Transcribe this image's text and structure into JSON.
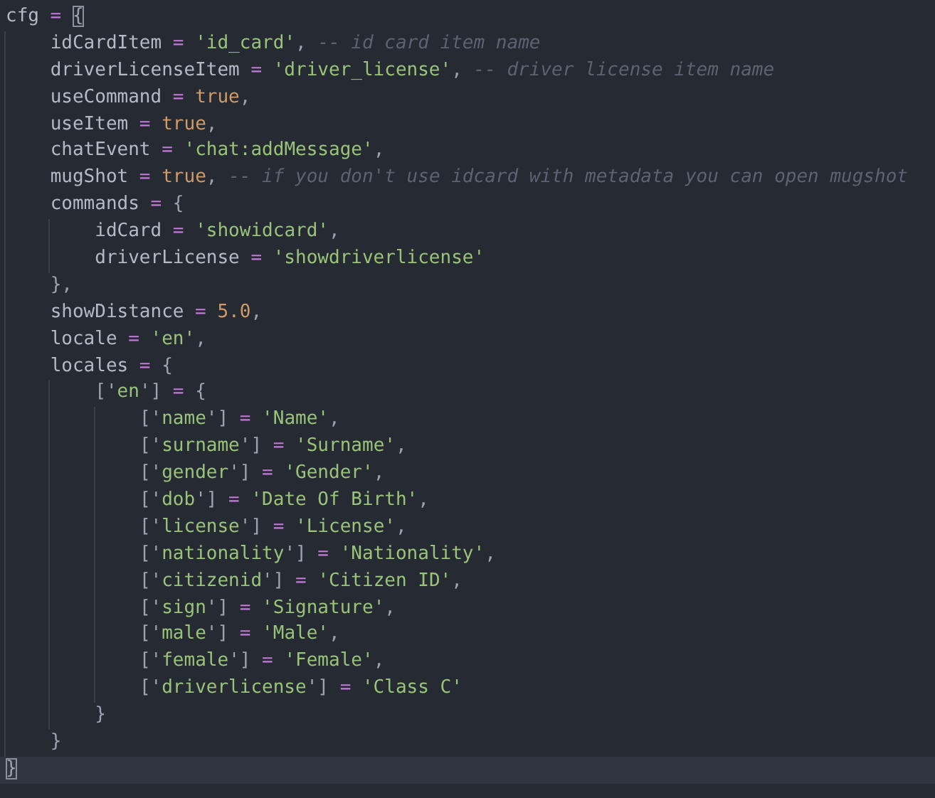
{
  "editor": {
    "lines": [
      {
        "current": false,
        "tokens": [
          {
            "kind": "id",
            "text": "cfg"
          },
          {
            "kind": "op",
            "text": " = "
          },
          {
            "kind": "pun",
            "text": "{",
            "matched": true
          }
        ],
        "children": [
          {
            "current": false,
            "tokens": [
              {
                "kind": "id",
                "text": "idCardItem"
              },
              {
                "kind": "op",
                "text": " = "
              },
              {
                "kind": "str",
                "text": "'id_card'"
              },
              {
                "kind": "pun",
                "text": ", "
              },
              {
                "kind": "cmt",
                "text": "-- id card item name"
              }
            ]
          },
          {
            "current": false,
            "tokens": [
              {
                "kind": "id",
                "text": "driverLicenseItem"
              },
              {
                "kind": "op",
                "text": " = "
              },
              {
                "kind": "str",
                "text": "'driver_license'"
              },
              {
                "kind": "pun",
                "text": ", "
              },
              {
                "kind": "cmt",
                "text": "-- driver license item name"
              }
            ]
          },
          {
            "current": false,
            "tokens": [
              {
                "kind": "id",
                "text": "useCommand"
              },
              {
                "kind": "op",
                "text": " = "
              },
              {
                "kind": "lit",
                "text": "true"
              },
              {
                "kind": "pun",
                "text": ","
              }
            ]
          },
          {
            "current": false,
            "tokens": [
              {
                "kind": "id",
                "text": "useItem"
              },
              {
                "kind": "op",
                "text": " = "
              },
              {
                "kind": "lit",
                "text": "true"
              },
              {
                "kind": "pun",
                "text": ","
              }
            ]
          },
          {
            "current": false,
            "tokens": [
              {
                "kind": "id",
                "text": "chatEvent"
              },
              {
                "kind": "op",
                "text": " = "
              },
              {
                "kind": "str",
                "text": "'chat:addMessage'"
              },
              {
                "kind": "pun",
                "text": ","
              }
            ]
          },
          {
            "current": false,
            "tokens": [
              {
                "kind": "id",
                "text": "mugShot"
              },
              {
                "kind": "op",
                "text": " = "
              },
              {
                "kind": "lit",
                "text": "true"
              },
              {
                "kind": "pun",
                "text": ", "
              },
              {
                "kind": "cmt",
                "text": "-- if you don't use idcard with metadata you can open mugshot"
              }
            ]
          },
          {
            "current": false,
            "tokens": [
              {
                "kind": "id",
                "text": "commands"
              },
              {
                "kind": "op",
                "text": " = "
              },
              {
                "kind": "pun",
                "text": "{"
              }
            ],
            "children": [
              {
                "current": false,
                "tokens": [
                  {
                    "kind": "id",
                    "text": "idCard"
                  },
                  {
                    "kind": "op",
                    "text": " = "
                  },
                  {
                    "kind": "str",
                    "text": "'showidcard'"
                  },
                  {
                    "kind": "pun",
                    "text": ","
                  }
                ]
              },
              {
                "current": false,
                "tokens": [
                  {
                    "kind": "id",
                    "text": "driverLicense"
                  },
                  {
                    "kind": "op",
                    "text": " = "
                  },
                  {
                    "kind": "str",
                    "text": "'showdriverlicense'"
                  }
                ]
              }
            ]
          },
          {
            "current": false,
            "tokens": [
              {
                "kind": "pun",
                "text": "},"
              }
            ]
          },
          {
            "current": false,
            "tokens": [
              {
                "kind": "id",
                "text": "showDistance"
              },
              {
                "kind": "op",
                "text": " = "
              },
              {
                "kind": "lit",
                "text": "5.0"
              },
              {
                "kind": "pun",
                "text": ","
              }
            ]
          },
          {
            "current": false,
            "tokens": [
              {
                "kind": "id",
                "text": "locale"
              },
              {
                "kind": "op",
                "text": " = "
              },
              {
                "kind": "str",
                "text": "'en'"
              },
              {
                "kind": "pun",
                "text": ","
              }
            ]
          },
          {
            "current": false,
            "tokens": [
              {
                "kind": "id",
                "text": "locales"
              },
              {
                "kind": "op",
                "text": " = "
              },
              {
                "kind": "pun",
                "text": "{"
              }
            ],
            "children": [
              {
                "current": false,
                "tokens": [
                  {
                    "kind": "pun",
                    "text": "['"
                  },
                  {
                    "kind": "str",
                    "text": "en"
                  },
                  {
                    "kind": "pun",
                    "text": "']"
                  },
                  {
                    "kind": "op",
                    "text": " = "
                  },
                  {
                    "kind": "pun",
                    "text": "{"
                  }
                ],
                "children": [
                  {
                    "current": false,
                    "tokens": [
                      {
                        "kind": "pun",
                        "text": "['"
                      },
                      {
                        "kind": "str",
                        "text": "name"
                      },
                      {
                        "kind": "pun",
                        "text": "']"
                      },
                      {
                        "kind": "op",
                        "text": " = "
                      },
                      {
                        "kind": "str",
                        "text": "'Name'"
                      },
                      {
                        "kind": "pun",
                        "text": ","
                      }
                    ]
                  },
                  {
                    "current": false,
                    "tokens": [
                      {
                        "kind": "pun",
                        "text": "['"
                      },
                      {
                        "kind": "str",
                        "text": "surname"
                      },
                      {
                        "kind": "pun",
                        "text": "']"
                      },
                      {
                        "kind": "op",
                        "text": " = "
                      },
                      {
                        "kind": "str",
                        "text": "'Surname'"
                      },
                      {
                        "kind": "pun",
                        "text": ","
                      }
                    ]
                  },
                  {
                    "current": false,
                    "tokens": [
                      {
                        "kind": "pun",
                        "text": "['"
                      },
                      {
                        "kind": "str",
                        "text": "gender"
                      },
                      {
                        "kind": "pun",
                        "text": "']"
                      },
                      {
                        "kind": "op",
                        "text": " = "
                      },
                      {
                        "kind": "str",
                        "text": "'Gender'"
                      },
                      {
                        "kind": "pun",
                        "text": ","
                      }
                    ]
                  },
                  {
                    "current": false,
                    "tokens": [
                      {
                        "kind": "pun",
                        "text": "['"
                      },
                      {
                        "kind": "str",
                        "text": "dob"
                      },
                      {
                        "kind": "pun",
                        "text": "']"
                      },
                      {
                        "kind": "op",
                        "text": " = "
                      },
                      {
                        "kind": "str",
                        "text": "'Date Of Birth'"
                      },
                      {
                        "kind": "pun",
                        "text": ","
                      }
                    ]
                  },
                  {
                    "current": false,
                    "tokens": [
                      {
                        "kind": "pun",
                        "text": "['"
                      },
                      {
                        "kind": "str",
                        "text": "license"
                      },
                      {
                        "kind": "pun",
                        "text": "']"
                      },
                      {
                        "kind": "op",
                        "text": " = "
                      },
                      {
                        "kind": "str",
                        "text": "'License'"
                      },
                      {
                        "kind": "pun",
                        "text": ","
                      }
                    ]
                  },
                  {
                    "current": false,
                    "tokens": [
                      {
                        "kind": "pun",
                        "text": "['"
                      },
                      {
                        "kind": "str",
                        "text": "nationality"
                      },
                      {
                        "kind": "pun",
                        "text": "']"
                      },
                      {
                        "kind": "op",
                        "text": " = "
                      },
                      {
                        "kind": "str",
                        "text": "'Nationality'"
                      },
                      {
                        "kind": "pun",
                        "text": ","
                      }
                    ]
                  },
                  {
                    "current": false,
                    "tokens": [
                      {
                        "kind": "pun",
                        "text": "['"
                      },
                      {
                        "kind": "str",
                        "text": "citizenid"
                      },
                      {
                        "kind": "pun",
                        "text": "']"
                      },
                      {
                        "kind": "op",
                        "text": " = "
                      },
                      {
                        "kind": "str",
                        "text": "'Citizen ID'"
                      },
                      {
                        "kind": "pun",
                        "text": ","
                      }
                    ]
                  },
                  {
                    "current": false,
                    "tokens": [
                      {
                        "kind": "pun",
                        "text": "['"
                      },
                      {
                        "kind": "str",
                        "text": "sign"
                      },
                      {
                        "kind": "pun",
                        "text": "']"
                      },
                      {
                        "kind": "op",
                        "text": " = "
                      },
                      {
                        "kind": "str",
                        "text": "'Signature'"
                      },
                      {
                        "kind": "pun",
                        "text": ","
                      }
                    ]
                  },
                  {
                    "current": false,
                    "tokens": [
                      {
                        "kind": "pun",
                        "text": "['"
                      },
                      {
                        "kind": "str",
                        "text": "male"
                      },
                      {
                        "kind": "pun",
                        "text": "']"
                      },
                      {
                        "kind": "op",
                        "text": " = "
                      },
                      {
                        "kind": "str",
                        "text": "'Male'"
                      },
                      {
                        "kind": "pun",
                        "text": ","
                      }
                    ]
                  },
                  {
                    "current": false,
                    "tokens": [
                      {
                        "kind": "pun",
                        "text": "['"
                      },
                      {
                        "kind": "str",
                        "text": "female"
                      },
                      {
                        "kind": "pun",
                        "text": "']"
                      },
                      {
                        "kind": "op",
                        "text": " = "
                      },
                      {
                        "kind": "str",
                        "text": "'Female'"
                      },
                      {
                        "kind": "pun",
                        "text": ","
                      }
                    ]
                  },
                  {
                    "current": false,
                    "tokens": [
                      {
                        "kind": "pun",
                        "text": "['"
                      },
                      {
                        "kind": "str",
                        "text": "driverlicense"
                      },
                      {
                        "kind": "pun",
                        "text": "']"
                      },
                      {
                        "kind": "op",
                        "text": " = "
                      },
                      {
                        "kind": "str",
                        "text": "'Class C'"
                      }
                    ]
                  }
                ]
              },
              {
                "current": false,
                "tokens": [
                  {
                    "kind": "pun",
                    "text": "}"
                  }
                ]
              }
            ]
          },
          {
            "current": false,
            "tokens": [
              {
                "kind": "pun",
                "text": "}"
              }
            ]
          }
        ]
      },
      {
        "current": true,
        "tokens": [
          {
            "kind": "pun",
            "text": "}",
            "matched": true
          }
        ]
      }
    ]
  }
}
